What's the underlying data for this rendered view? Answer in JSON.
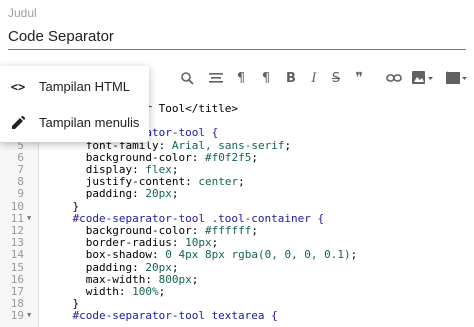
{
  "title_field": {
    "label": "Judul",
    "value": "Code Separator"
  },
  "mode_menu": {
    "items": [
      {
        "icon": "code-icon",
        "glyph": "<>",
        "label": "Tampilan HTML"
      },
      {
        "icon": "pencil-icon",
        "glyph": "",
        "label": "Tampilan menulis"
      }
    ]
  },
  "toolbar": {
    "buttons": [
      "search-icon",
      "align-icon",
      "paragraph-icon",
      "paragraph-rtl-icon",
      "bold-icon",
      "italic-icon",
      "strikethrough-icon",
      "quote-icon",
      "link-icon",
      "image-icon",
      "video-icon"
    ],
    "bold": "B",
    "italic": "I",
    "strike": "S",
    "quote": "❞",
    "para": "¶"
  },
  "editor": {
    "lines": [
      {
        "n": "",
        "fold": "",
        "text": "           rator Tool</title>"
      },
      {
        "n": "",
        "fold": "",
        "text": ""
      },
      {
        "n": "4",
        "fold": "▼",
        "text": "    #code-separator-tool {"
      },
      {
        "n": "5",
        "fold": "",
        "text": "      font-family: Arial, sans-serif;"
      },
      {
        "n": "6",
        "fold": "",
        "text": "      background-color: #f0f2f5;"
      },
      {
        "n": "7",
        "fold": "",
        "text": "      display: flex;"
      },
      {
        "n": "8",
        "fold": "",
        "text": "      justify-content: center;"
      },
      {
        "n": "9",
        "fold": "",
        "text": "      padding: 20px;"
      },
      {
        "n": "10",
        "fold": "",
        "text": "    }"
      },
      {
        "n": "11",
        "fold": "▼",
        "text": "    #code-separator-tool .tool-container {"
      },
      {
        "n": "12",
        "fold": "",
        "text": "      background-color: #ffffff;"
      },
      {
        "n": "13",
        "fold": "",
        "text": "      border-radius: 10px;"
      },
      {
        "n": "14",
        "fold": "",
        "text": "      box-shadow: 0 4px 8px rgba(0, 0, 0, 0.1);"
      },
      {
        "n": "15",
        "fold": "",
        "text": "      padding: 20px;"
      },
      {
        "n": "16",
        "fold": "",
        "text": "      max-width: 800px;"
      },
      {
        "n": "17",
        "fold": "",
        "text": "      width: 100%;"
      },
      {
        "n": "18",
        "fold": "",
        "text": "    }"
      },
      {
        "n": "19",
        "fold": "▼",
        "text": "    #code-separator-tool textarea {"
      }
    ]
  },
  "colors": {
    "accent": "#e65100",
    "selector": "#1a1aa6",
    "property": "#000000",
    "value_num": "#116644",
    "value_str": "#3300aa"
  }
}
